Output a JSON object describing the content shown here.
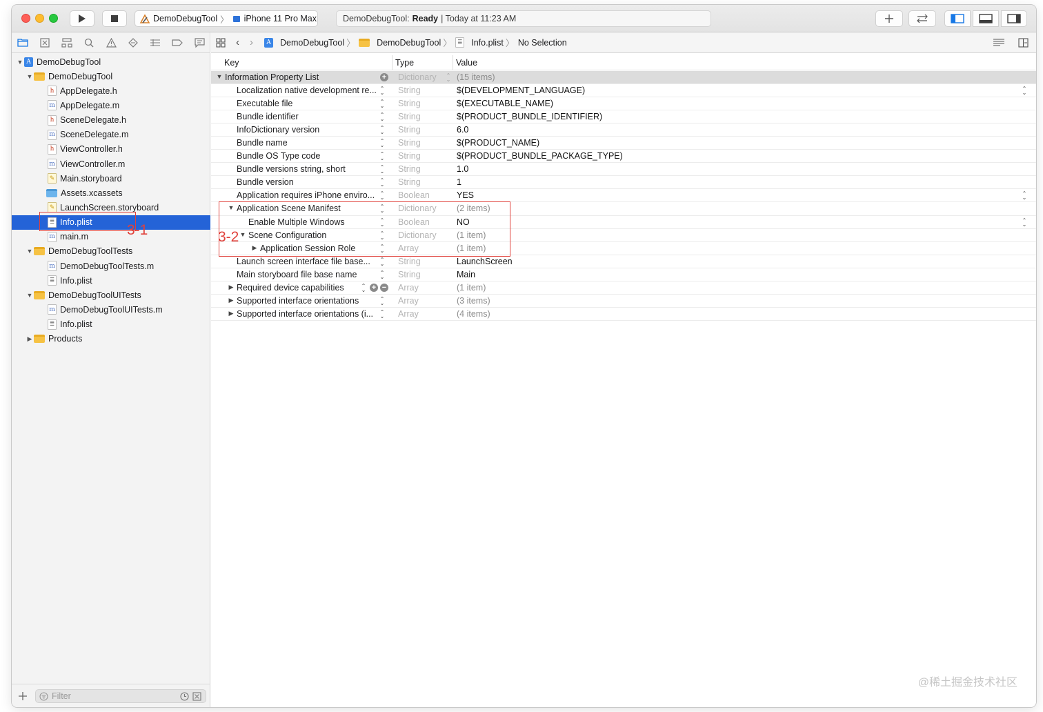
{
  "toolbar": {
    "scheme_project": "DemoDebugTool",
    "scheme_device": "iPhone 11 Pro Max",
    "status_prefix": "DemoDebugTool:",
    "status_state": "Ready",
    "status_time": "| Today at 11:23 AM"
  },
  "navigator": {
    "tree": [
      {
        "label": "DemoDebugTool",
        "icon": "project-icon",
        "disc": "▼"
      },
      {
        "label": "DemoDebugTool",
        "icon": "folder-icon",
        "disc": "▼"
      },
      {
        "label": "AppDelegate.h",
        "icon": "header-file-icon",
        "disc": ""
      },
      {
        "label": "AppDelegate.m",
        "icon": "objc-file-icon",
        "disc": ""
      },
      {
        "label": "SceneDelegate.h",
        "icon": "header-file-icon",
        "disc": ""
      },
      {
        "label": "SceneDelegate.m",
        "icon": "objc-file-icon",
        "disc": ""
      },
      {
        "label": "ViewController.h",
        "icon": "header-file-icon",
        "disc": ""
      },
      {
        "label": "ViewController.m",
        "icon": "objc-file-icon",
        "disc": ""
      },
      {
        "label": "Main.storyboard",
        "icon": "storyboard-icon",
        "disc": ""
      },
      {
        "label": "Assets.xcassets",
        "icon": "assets-folder-icon",
        "disc": ""
      },
      {
        "label": "LaunchScreen.storyboard",
        "icon": "storyboard-icon",
        "disc": ""
      },
      {
        "label": "Info.plist",
        "icon": "plist-icon",
        "disc": ""
      },
      {
        "label": "main.m",
        "icon": "objc-file-icon",
        "disc": ""
      },
      {
        "label": "DemoDebugToolTests",
        "icon": "folder-icon",
        "disc": "▼"
      },
      {
        "label": "DemoDebugToolTests.m",
        "icon": "objc-file-icon",
        "disc": ""
      },
      {
        "label": "Info.plist",
        "icon": "plist-icon",
        "disc": ""
      },
      {
        "label": "DemoDebugToolUITests",
        "icon": "folder-icon",
        "disc": "▼"
      },
      {
        "label": "DemoDebugToolUITests.m",
        "icon": "objc-file-icon",
        "disc": ""
      },
      {
        "label": "Info.plist",
        "icon": "plist-icon",
        "disc": ""
      },
      {
        "label": "Products",
        "icon": "folder-icon",
        "disc": "▶"
      }
    ],
    "filter_placeholder": "Filter"
  },
  "jumpbar": {
    "crumbs": [
      "DemoDebugTool",
      "DemoDebugTool",
      "Info.plist",
      "No Selection"
    ]
  },
  "plist": {
    "headers": {
      "key": "Key",
      "type": "Type",
      "value": "Value"
    },
    "rows": [
      {
        "key": "Information Property List",
        "type": "Dictionary",
        "value": "(15 items)"
      },
      {
        "key": "Localization native development re...",
        "type": "String",
        "value": "$(DEVELOPMENT_LANGUAGE)"
      },
      {
        "key": "Executable file",
        "type": "String",
        "value": "$(EXECUTABLE_NAME)"
      },
      {
        "key": "Bundle identifier",
        "type": "String",
        "value": "$(PRODUCT_BUNDLE_IDENTIFIER)"
      },
      {
        "key": "InfoDictionary version",
        "type": "String",
        "value": "6.0"
      },
      {
        "key": "Bundle name",
        "type": "String",
        "value": "$(PRODUCT_NAME)"
      },
      {
        "key": "Bundle OS Type code",
        "type": "String",
        "value": "$(PRODUCT_BUNDLE_PACKAGE_TYPE)"
      },
      {
        "key": "Bundle versions string, short",
        "type": "String",
        "value": "1.0"
      },
      {
        "key": "Bundle version",
        "type": "String",
        "value": "1"
      },
      {
        "key": "Application requires iPhone enviro...",
        "type": "Boolean",
        "value": "YES"
      },
      {
        "key": "Application Scene Manifest",
        "type": "Dictionary",
        "value": "(2 items)"
      },
      {
        "key": "Enable Multiple Windows",
        "type": "Boolean",
        "value": "NO"
      },
      {
        "key": "Scene Configuration",
        "type": "Dictionary",
        "value": "(1 item)"
      },
      {
        "key": "Application Session Role",
        "type": "Array",
        "value": "(1 item)"
      },
      {
        "key": "Launch screen interface file base...",
        "type": "String",
        "value": "LaunchScreen"
      },
      {
        "key": "Main storyboard file base name",
        "type": "String",
        "value": "Main"
      },
      {
        "key": "Required device capabilities",
        "type": "Array",
        "value": "(1 item)"
      },
      {
        "key": "Supported interface orientations",
        "type": "Array",
        "value": "(3 items)"
      },
      {
        "key": "Supported interface orientations (i...",
        "type": "Array",
        "value": "(4 items)"
      }
    ]
  },
  "annotations": {
    "label_1": "3-1",
    "label_2": "3-2",
    "color": "#e0413b"
  },
  "watermark": "@稀土掘金技术社区",
  "colors": {
    "selection": "#2463d7",
    "accent": "#1677e5"
  }
}
